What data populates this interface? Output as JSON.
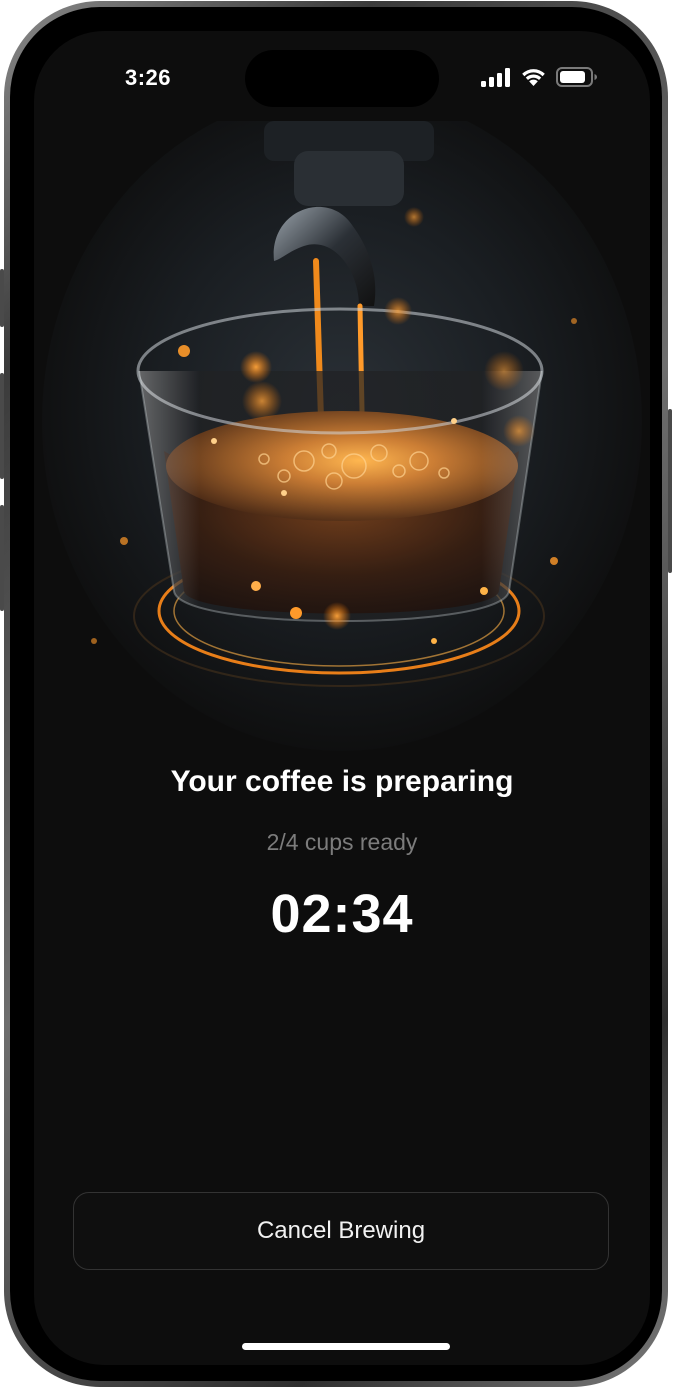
{
  "status_bar": {
    "time": "3:26",
    "icons": [
      "cellular-signal-icon",
      "wifi-icon",
      "battery-icon"
    ]
  },
  "hero": {
    "image": "espresso-cup-illustration",
    "colors": {
      "accent": "#ff8a1a",
      "coffee": "#3a1a08",
      "crema": "#c9772a"
    }
  },
  "brewing": {
    "title": "Your coffee is preparing",
    "progress_text": "2/4 cups ready",
    "cups_ready": 2,
    "cups_total": 4,
    "timer": "02:34"
  },
  "actions": {
    "cancel_label": "Cancel Brewing"
  },
  "theme": {
    "background": "#0d0d0d",
    "text_primary": "#ffffff",
    "text_secondary": "#7c7c7c",
    "button_border": "#333333"
  }
}
